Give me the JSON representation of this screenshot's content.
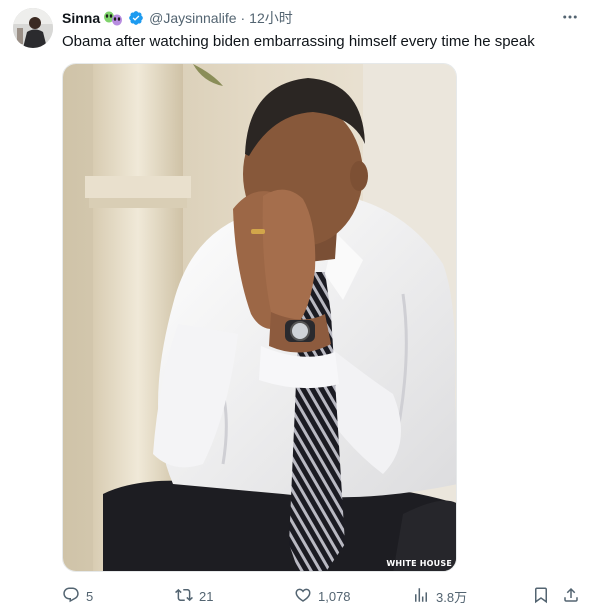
{
  "tweet": {
    "author": {
      "display_name": "Sinna",
      "name_emoji": "alien-faces-emoji",
      "handle": "@Jaysinnalife",
      "verified": true,
      "timestamp": "12小时"
    },
    "separator": "·",
    "text": "Obama after watching biden embarrassing himself every time he speak",
    "media": {
      "watermark": "WHITE HOUSE"
    },
    "actions": {
      "replies": "5",
      "reposts": "21",
      "likes": "1,078",
      "views": "3.8万"
    }
  },
  "colors": {
    "text_primary": "#0f1419",
    "text_secondary": "#536471",
    "verified_blue": "#1d9bf0"
  }
}
